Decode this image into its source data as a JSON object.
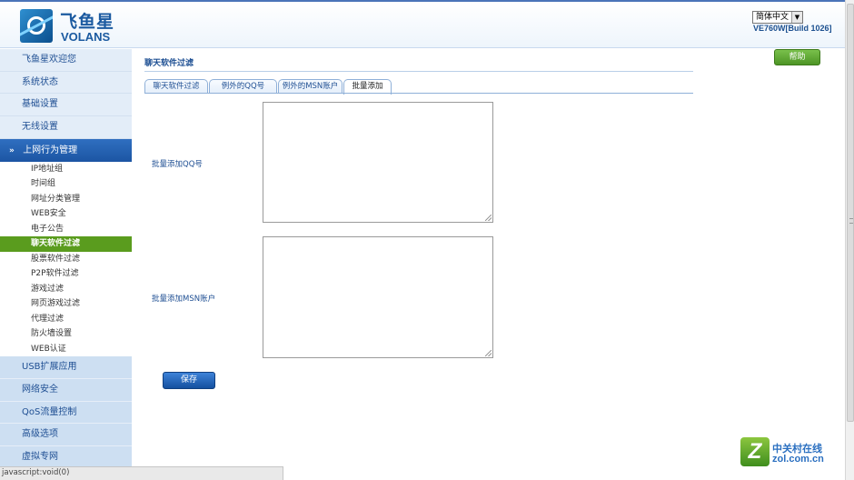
{
  "header": {
    "logo_cn": "飞鱼星",
    "logo_en": "VOLANS",
    "language": "简体中文",
    "build": "VE760W[Build 1026]"
  },
  "sidebar": {
    "top_items": [
      "飞鱼星欢迎您",
      "系统状态",
      "基础设置",
      "无线设置"
    ],
    "section": "上网行为管理",
    "sub_items": [
      "IP地址组",
      "时间组",
      "网址分类管理",
      "WEB安全",
      "电子公告",
      "聊天软件过滤",
      "股票软件过滤",
      "P2P软件过滤",
      "游戏过滤",
      "网页游戏过滤",
      "代理过滤",
      "防火墙设置",
      "WEB认证"
    ],
    "active_sub": "聊天软件过滤",
    "bottom_items": [
      "USB扩展应用",
      "网络安全",
      "QoS流量控制",
      "高级选项",
      "虚拟专网"
    ]
  },
  "content": {
    "help": "帮助",
    "title": "聊天软件过滤",
    "tabs": [
      "聊天软件过滤",
      "例外的QQ号",
      "例外的MSN账户",
      "批量添加"
    ],
    "active_tab": "批量添加",
    "qq_label": "批量添加QQ号",
    "qq_value": "",
    "msn_label": "批量添加MSN账户",
    "msn_value": "",
    "save": "保存"
  },
  "statusbar": {
    "text": "javascript:void(0)"
  },
  "watermark": {
    "cn": "中关村在线",
    "en": "zol.com.cn",
    "mark": "Z"
  },
  "colors": {
    "accent": "#1c55a3",
    "active_nav": "#5a9c1e",
    "help_button": "#5ea532"
  }
}
